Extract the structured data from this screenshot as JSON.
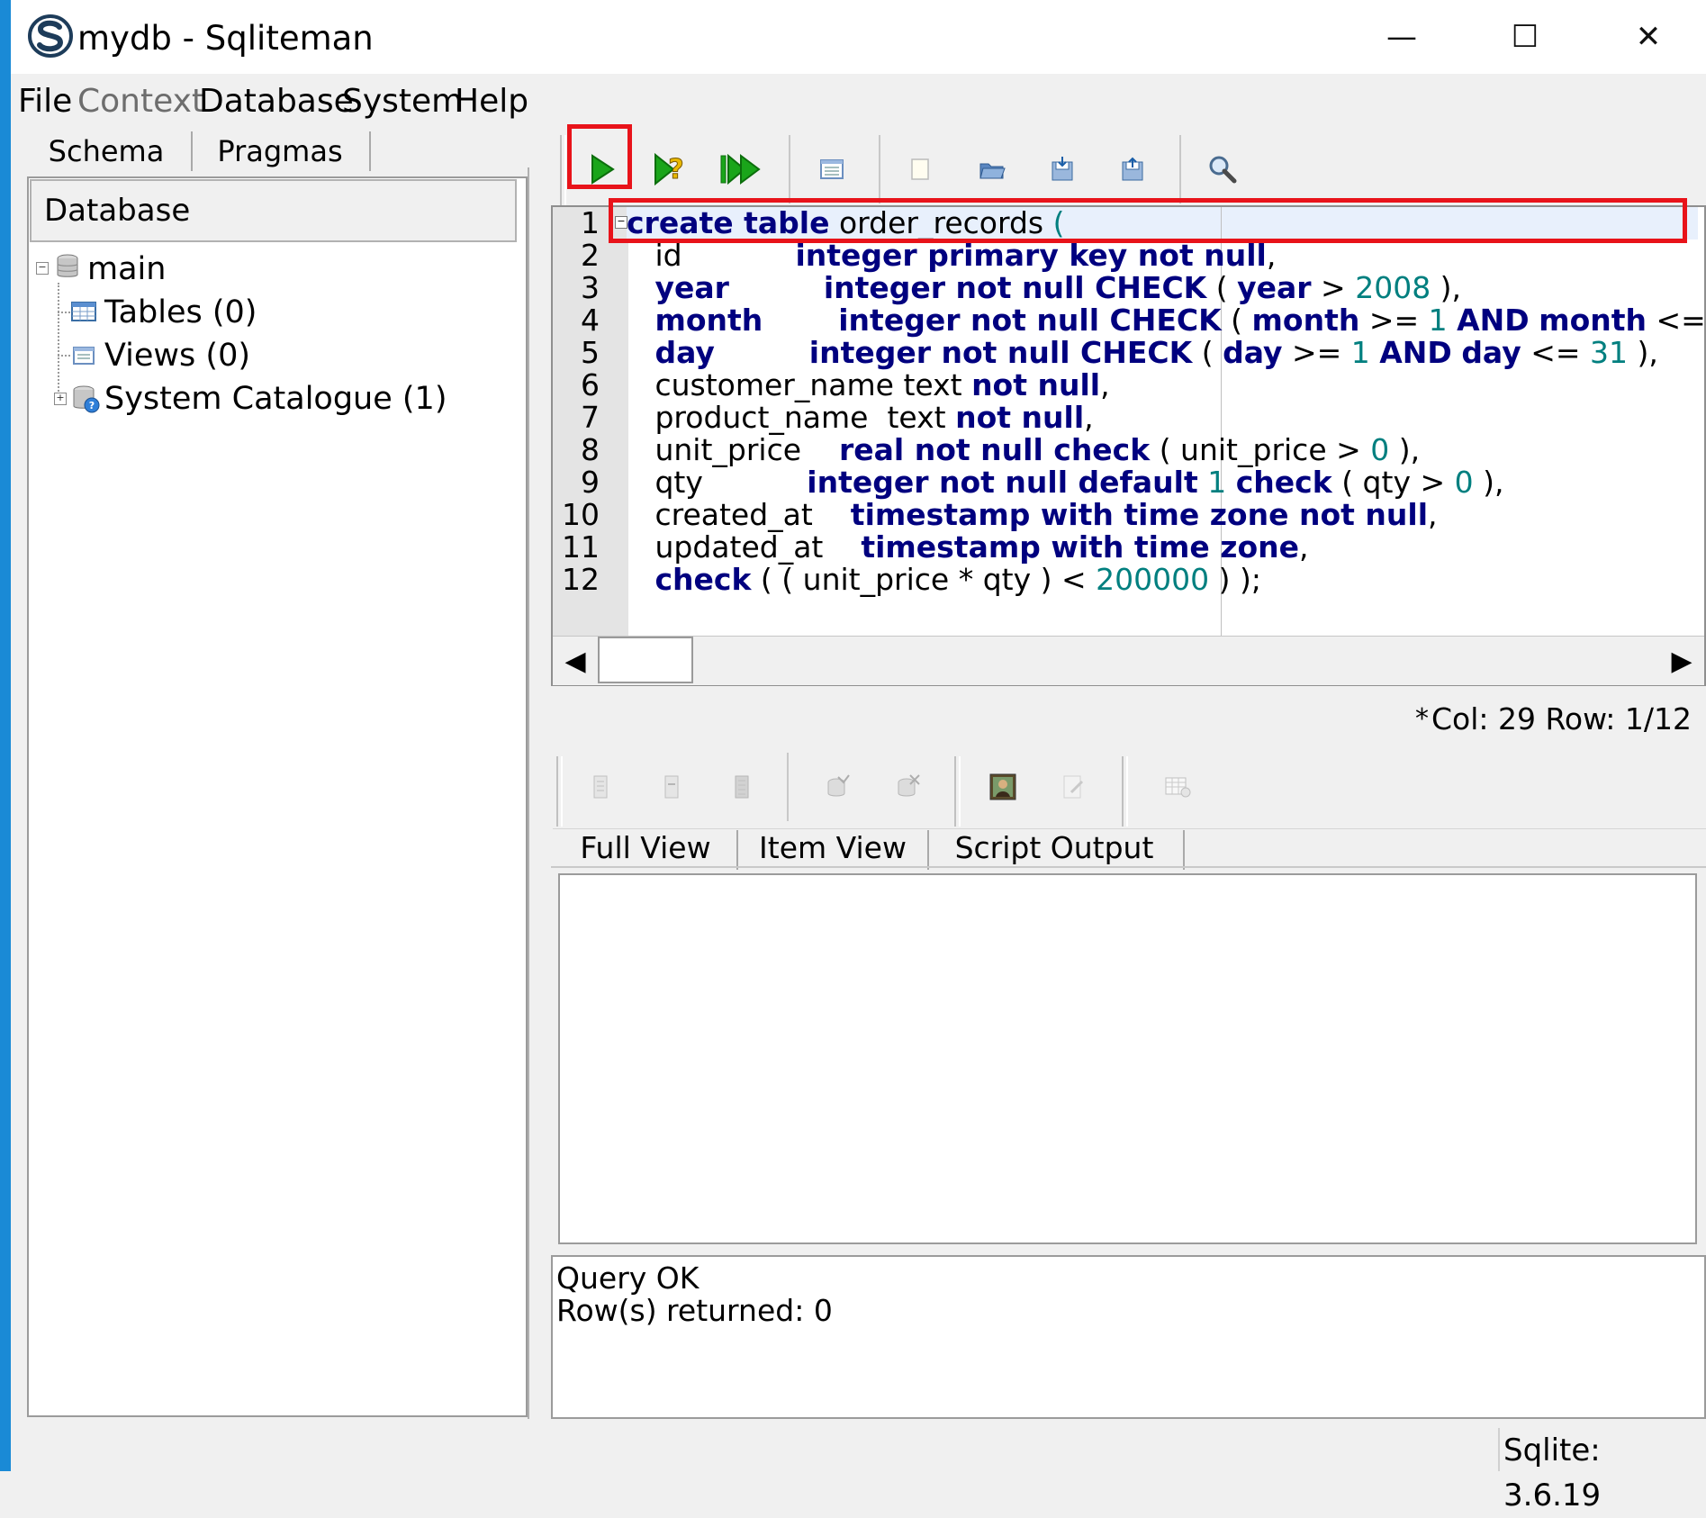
{
  "window": {
    "title": "mydb - Sqliteman",
    "controls": {
      "minimize": "—",
      "maximize": "☐",
      "close": "✕"
    }
  },
  "menu": {
    "items": [
      "File",
      "Context",
      "Database",
      "System",
      "Help"
    ],
    "disabled": [
      "Context"
    ]
  },
  "left_panel": {
    "tabs": [
      "Schema",
      "Pragmas"
    ],
    "header": "Database",
    "tree": {
      "root": "main",
      "children": [
        "Tables (0)",
        "Views (0)",
        "System Catalogue (1)"
      ]
    }
  },
  "toolbar": {
    "buttons": [
      "run-sql-icon",
      "explain-query-icon",
      "run-script-icon",
      "create-view-icon",
      "new-file-icon",
      "open-file-icon",
      "save-file-icon",
      "save-as-icon",
      "find-icon"
    ]
  },
  "editor": {
    "line_numbers": [
      "1",
      "2",
      "3",
      "4",
      "5",
      "6",
      "7",
      "8",
      "9",
      "10",
      "11",
      "12"
    ],
    "status": {
      "modified": "*",
      "position": "Col: 29 Row: 1/12"
    }
  },
  "result_tabs": [
    "Full View",
    "Item View",
    "Script Output"
  ],
  "output": {
    "line1": "Query OK",
    "line2": "Row(s) returned: 0"
  },
  "status_bar": {
    "version": "Sqlite: 3.6.19"
  },
  "colors": {
    "keyword": "#00007f",
    "number": "#007f7f",
    "highlight": "#e8131a",
    "desktop_edge": "#1a8ad6"
  }
}
